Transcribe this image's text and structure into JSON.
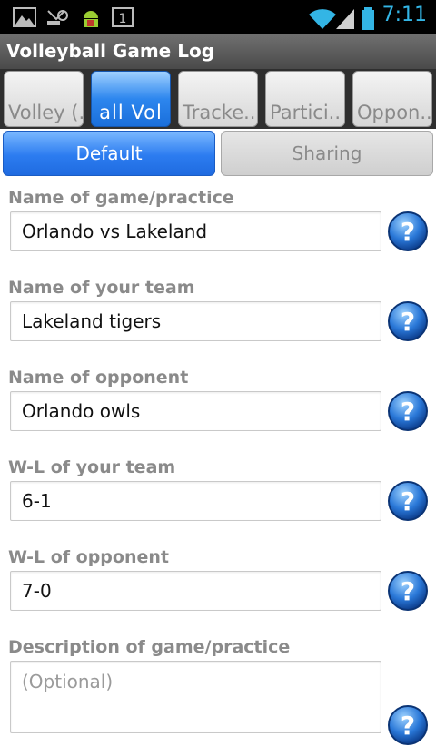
{
  "status_bar": {
    "time": "7:11",
    "icons": [
      "picture-icon",
      "missed-call-icon",
      "android-debug-icon",
      "notification-count-icon",
      "wifi-icon",
      "signal-icon",
      "battery-icon"
    ],
    "notification_count": "1"
  },
  "app": {
    "title": "Volleyball Game Log"
  },
  "tabs": [
    {
      "label": "Volley (..",
      "active": false
    },
    {
      "label": "all    Vol",
      "active": true
    },
    {
      "label": "Tracke..",
      "active": false
    },
    {
      "label": "Partici..",
      "active": false
    },
    {
      "label": "Oppon..",
      "active": false
    }
  ],
  "segments": {
    "default_label": "Default",
    "sharing_label": "Sharing"
  },
  "form": {
    "fields": [
      {
        "label": "Name of game/practice",
        "value": "Orlando vs Lakeland"
      },
      {
        "label": "Name of your team",
        "value": "Lakeland tigers"
      },
      {
        "label": "Name of opponent",
        "value": "Orlando owls"
      },
      {
        "label": "W-L of your team",
        "value": "6-1"
      },
      {
        "label": "W-L of opponent",
        "value": "7-0"
      },
      {
        "label": "Description of game/practice",
        "value": "",
        "placeholder": "(Optional)"
      }
    ]
  },
  "colors": {
    "accent_blue": "#2c7cf0",
    "clock_blue": "#33b5e5",
    "label_gray": "#8a8a8a"
  }
}
